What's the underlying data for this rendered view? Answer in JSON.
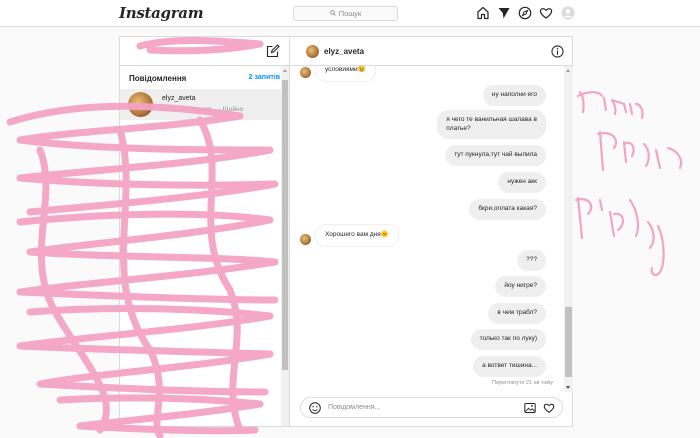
{
  "brand": "Instagram",
  "search": {
    "placeholder": "Пошук"
  },
  "nav_icons": [
    "home-icon",
    "direct-icon",
    "explore-icon",
    "heart-icon",
    "avatar"
  ],
  "inbox": {
    "header": "Повідомлення",
    "requests": "2 запитів",
    "conversations": [
      {
        "name": "elyz_aveta",
        "preview": "а вответ тишина... · Щойно"
      }
    ]
  },
  "chat": {
    "username": "elyz_aveta",
    "messages": [
      {
        "from": "them",
        "text": "условиями😉"
      },
      {
        "from": "me",
        "text": "ну наполни его"
      },
      {
        "from": "me",
        "text": "я чего те ванильная шалава в\nплатье?"
      },
      {
        "from": "me",
        "text": "тут пукнула,тут чай выпила"
      },
      {
        "from": "me",
        "text": "нужен акк"
      },
      {
        "from": "me",
        "text": "бкри,оплата какая?"
      },
      {
        "from": "them",
        "text": "Хорошего вам дня🌞"
      },
      {
        "from": "me",
        "text": "???"
      },
      {
        "from": "me",
        "text": "йоу нигре?"
      },
      {
        "from": "me",
        "text": "в чем трабл?"
      },
      {
        "from": "me",
        "text": "только так по луку)"
      },
      {
        "from": "me",
        "text": "а вответ тишина..."
      }
    ],
    "seen": "Переглянуто 21 хв тому",
    "composer_placeholder": "Повідомлення..."
  },
  "colors": {
    "accent": "#0095f6",
    "scribble": "#f4a3c4",
    "border": "#dbdbdb"
  }
}
